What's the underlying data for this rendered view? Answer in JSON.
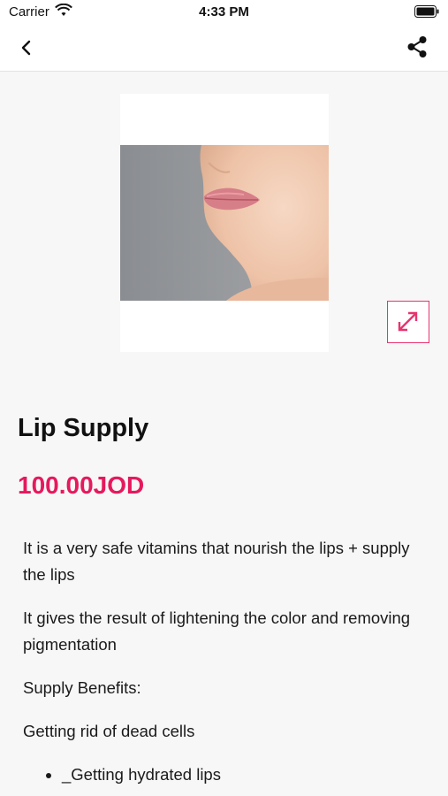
{
  "status_bar": {
    "carrier": "Carrier",
    "time": "4:33 PM"
  },
  "nav": {
    "back_icon": "chevron-left-icon",
    "share_icon": "share-icon"
  },
  "product": {
    "title": "Lip Supply",
    "price": "100.00JOD",
    "image_alt": "woman lips close-up",
    "expand_icon": "expand-arrows-icon",
    "description": [
      "It is a very safe vitamins that nourish the lips + supply the lips",
      "It gives the result of lightening the color and removing pigmentation",
      "Supply Benefits:",
      "Getting rid of dead cells"
    ],
    "bullets": [
      "_Getting hydrated lips"
    ]
  },
  "colors": {
    "accent": "#e5195d",
    "background": "#f7f7f7"
  }
}
